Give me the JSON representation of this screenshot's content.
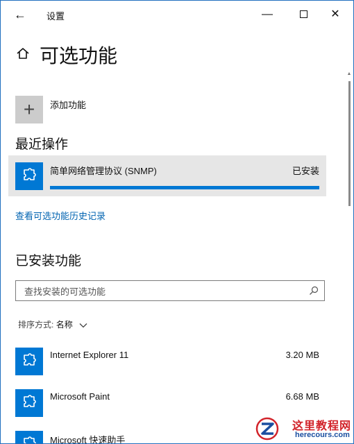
{
  "window": {
    "title": "设置",
    "back_glyph": "←",
    "minimize_glyph": "—",
    "close_glyph": "✕",
    "border_color": "#1f6fbf"
  },
  "page": {
    "title": "可选功能",
    "home_icon": "home-icon"
  },
  "add_feature": {
    "glyph": "+",
    "label": "添加功能"
  },
  "recent": {
    "heading": "最近操作",
    "item": {
      "name": "简单网络管理协议 (SNMP)",
      "status": "已安装",
      "progress": 1.0,
      "icon": "puzzle-icon"
    },
    "history_link": "查看可选功能历史记录"
  },
  "installed": {
    "heading": "已安装功能",
    "search_placeholder": "查找安装的可选功能",
    "sort_label": "排序方式:",
    "sort_value": "名称",
    "items": [
      {
        "name": "Internet Explorer 11",
        "size": "3.20 MB"
      },
      {
        "name": "Microsoft Paint",
        "size": "6.68 MB"
      },
      {
        "name": "Microsoft 快速助手",
        "size": ""
      }
    ]
  },
  "colors": {
    "accent": "#0078d4",
    "link": "#0063b1",
    "card_bg": "#e6e6e6"
  },
  "watermark": {
    "cn": "这里教程网",
    "en": "herecours.com"
  }
}
